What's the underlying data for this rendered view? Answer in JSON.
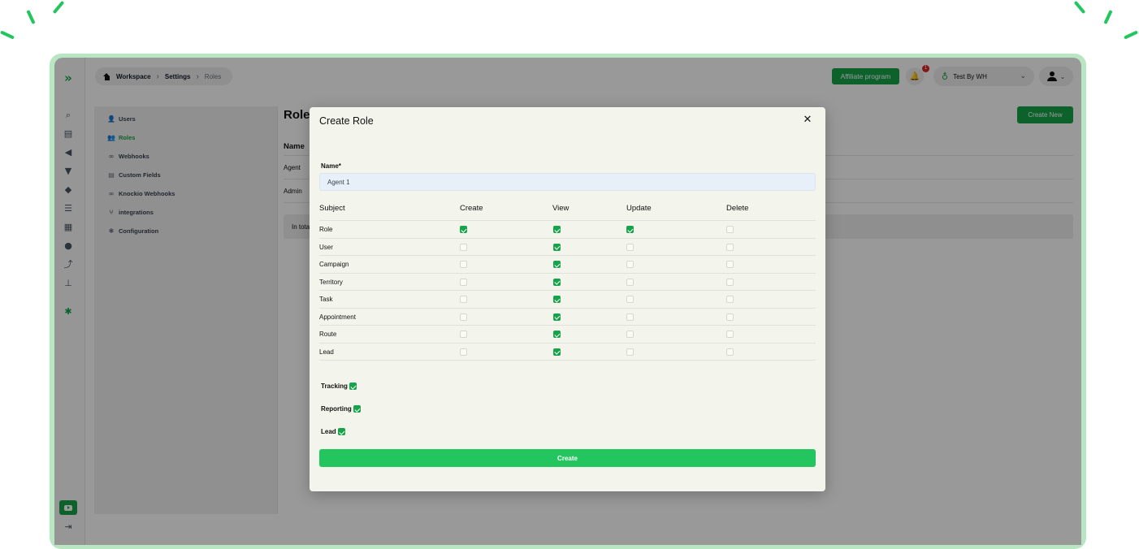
{
  "breadcrumb": {
    "items": [
      "Workspace",
      "Settings",
      "Roles"
    ]
  },
  "header": {
    "affiliate_label": "Affiliate program",
    "notification_count": "1",
    "workspace_name": "Test By WH"
  },
  "settings_menu": {
    "items": [
      {
        "label": "Users",
        "icon": "user-icon"
      },
      {
        "label": "Roles",
        "icon": "users-icon",
        "active": true
      },
      {
        "label": "Webhooks",
        "icon": "link-icon"
      },
      {
        "label": "Custom Fields",
        "icon": "list-icon"
      },
      {
        "label": "Knockio Webhooks",
        "icon": "link-icon"
      },
      {
        "label": "integrations",
        "icon": "branch-icon"
      },
      {
        "label": "Configuration",
        "icon": "gear-icon"
      }
    ]
  },
  "roles_page": {
    "title": "Roles",
    "create_new_label": "Create New",
    "table_header": "Name",
    "rows": [
      "Agent",
      "Admin"
    ],
    "footer": "In total"
  },
  "modal": {
    "title": "Create Role",
    "name_label": "Name*",
    "name_value": "Agent 1",
    "columns": [
      "Subject",
      "Create",
      "View",
      "Update",
      "Delete"
    ],
    "permissions": [
      {
        "subject": "Role",
        "create": true,
        "view": true,
        "update": true,
        "delete": false
      },
      {
        "subject": "User",
        "create": false,
        "view": true,
        "update": false,
        "delete": false
      },
      {
        "subject": "Campaign",
        "create": false,
        "view": true,
        "update": false,
        "delete": false
      },
      {
        "subject": "Territory",
        "create": false,
        "view": true,
        "update": false,
        "delete": false
      },
      {
        "subject": "Task",
        "create": false,
        "view": true,
        "update": false,
        "delete": false
      },
      {
        "subject": "Appointment",
        "create": false,
        "view": true,
        "update": false,
        "delete": false
      },
      {
        "subject": "Route",
        "create": false,
        "view": true,
        "update": false,
        "delete": false
      },
      {
        "subject": "Lead",
        "create": false,
        "view": true,
        "update": false,
        "delete": false
      }
    ],
    "extras": [
      {
        "label": "Tracking",
        "checked": true
      },
      {
        "label": "Reporting",
        "checked": true
      },
      {
        "label": "Lead",
        "checked": true
      }
    ],
    "create_label": "Create"
  },
  "colors": {
    "accent": "#16a34a",
    "create_button": "#22c55e",
    "frame": "#b8e6c3"
  }
}
